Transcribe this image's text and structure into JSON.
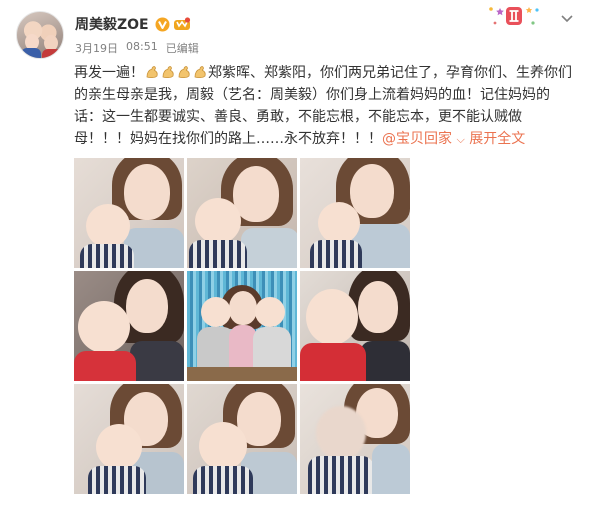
{
  "user": {
    "name": "周美毅ZOE",
    "avatar_icon": "avatar-photo",
    "verified_icon": "verified-v-icon",
    "vip_icon": "vip-crown-icon"
  },
  "meta": {
    "date": "3月19日",
    "time": "08:51",
    "edited": "已编辑"
  },
  "badge": {
    "icon": "gemini-zodiac-badge-icon",
    "accent": "#e9505a"
  },
  "post": {
    "text_before_emoji": "再发一遍！",
    "emoji_icon": "strong-arm-emoji",
    "emoji_count": 4,
    "text_main": "郑紫晖、郑紫阳，你们两兄弟记住了，孕育你们、生养你们的亲生母亲是我，周毅（艺名：周美毅）你们身上流着妈妈的血！记住妈妈的话：这一生都要诚实、善良、勇敢，不能忘根，不能忘本，更不能认贼做母！！！妈妈在找你们的路上……永不放弃！！！",
    "mention": "@宝贝回家",
    "expand_label": "展开全文",
    "expand_icon": "chevron-down-small-icon"
  },
  "photos": [
    {
      "label": "photo-1"
    },
    {
      "label": "photo-2"
    },
    {
      "label": "photo-3"
    },
    {
      "label": "photo-4"
    },
    {
      "label": "photo-5"
    },
    {
      "label": "photo-6"
    },
    {
      "label": "photo-7"
    },
    {
      "label": "photo-8"
    },
    {
      "label": "photo-9"
    }
  ],
  "colors": {
    "link": "#eb7350",
    "muted": "#808080",
    "verified": "#f5a623"
  }
}
